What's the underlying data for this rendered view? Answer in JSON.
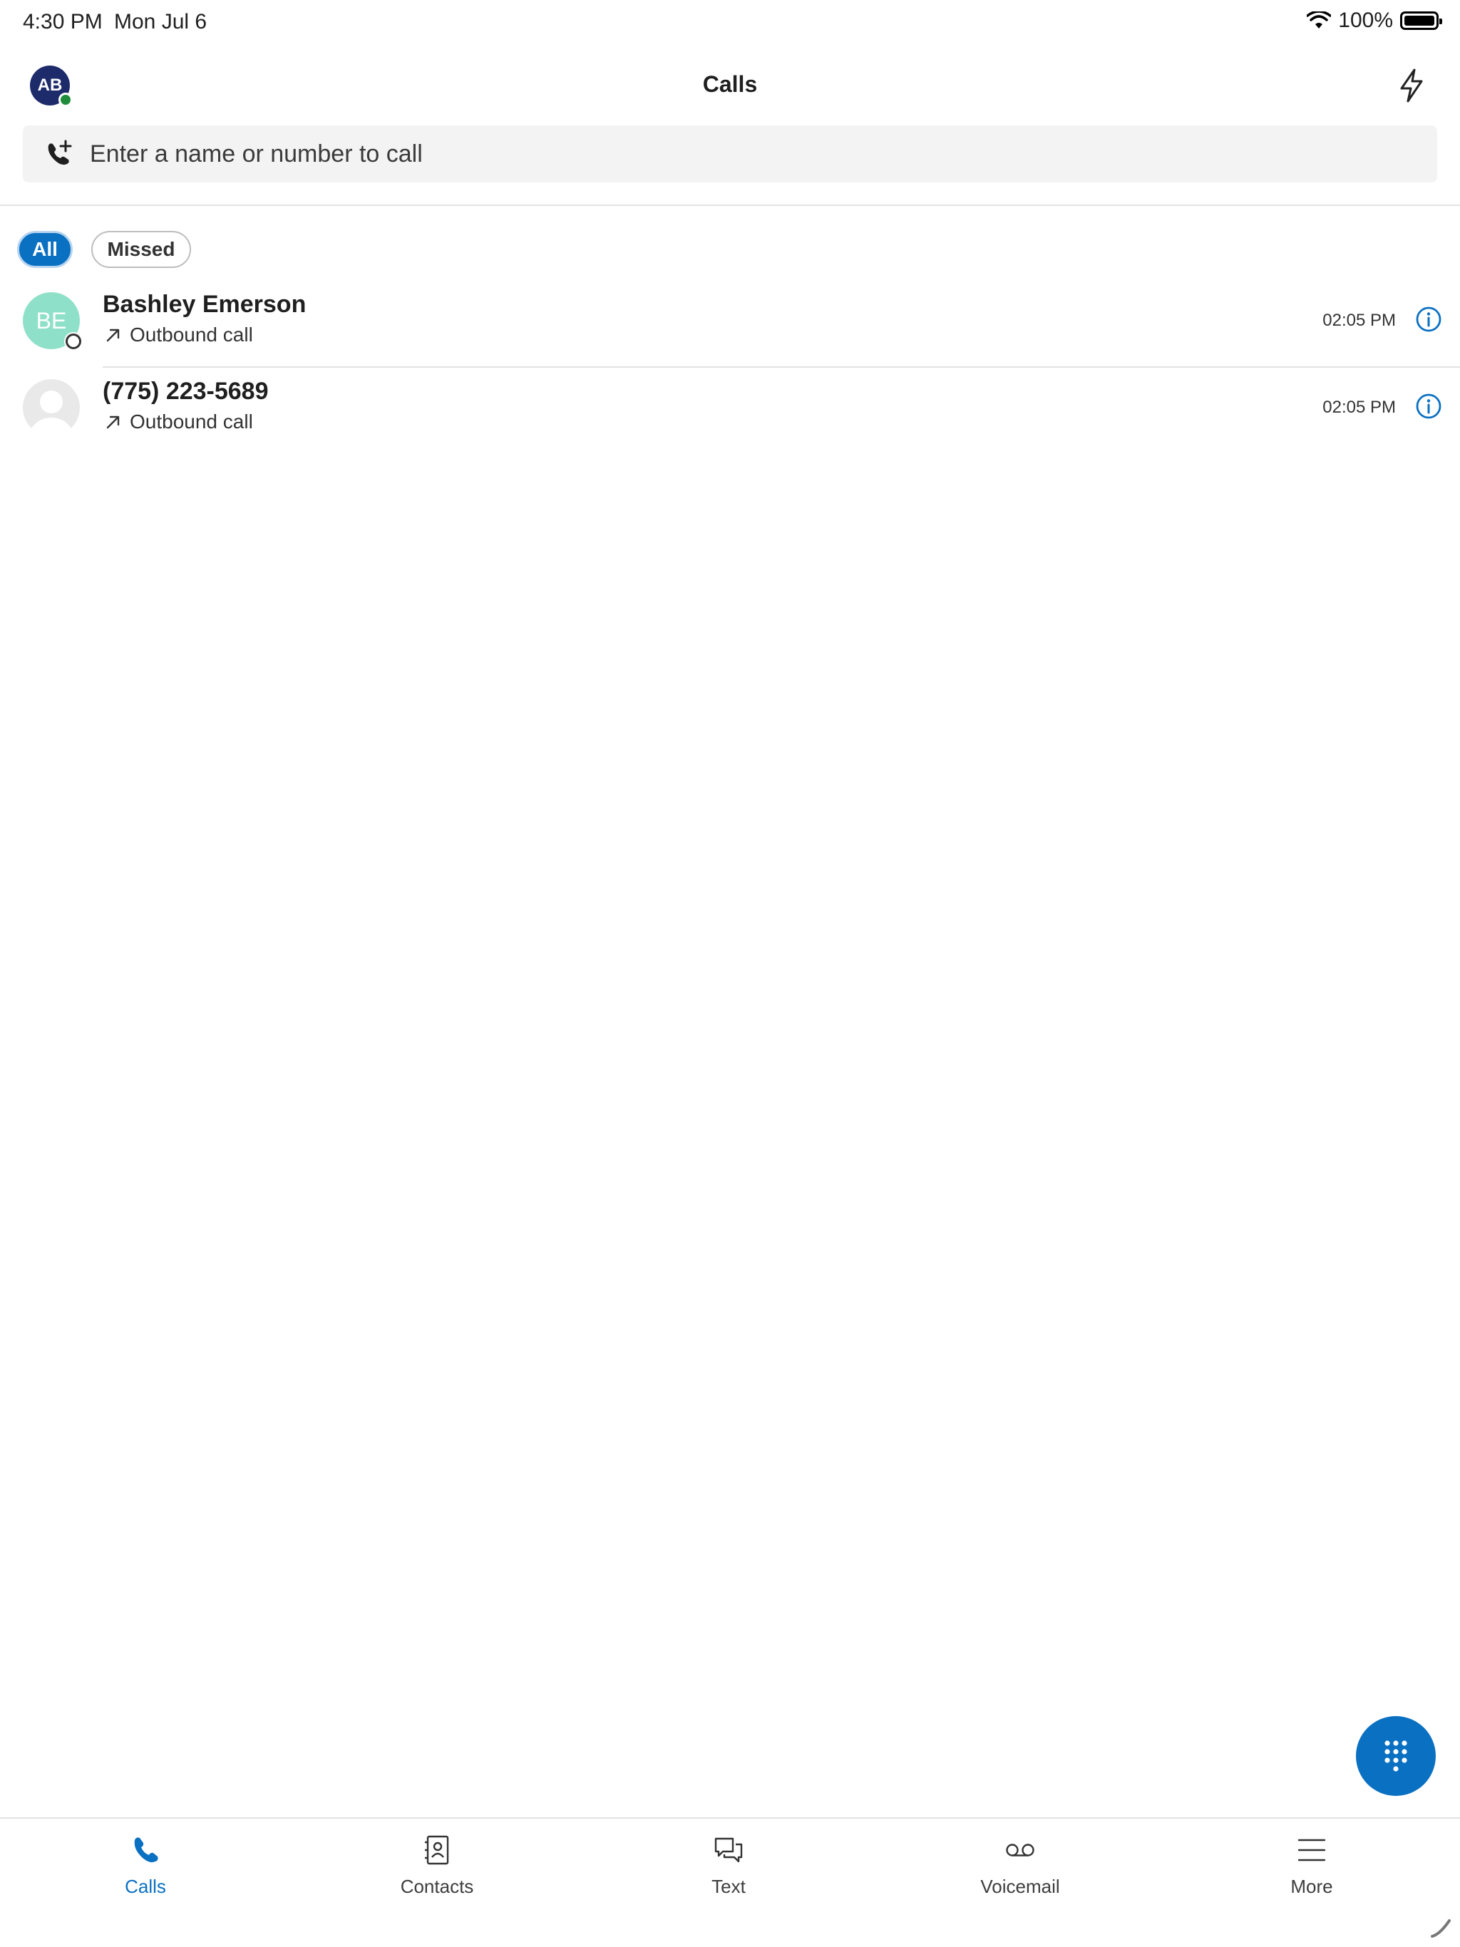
{
  "status_bar": {
    "time": "4:30 PM",
    "date": "Mon Jul 6",
    "battery": "100%"
  },
  "header": {
    "title": "Calls",
    "avatar_initials": "AB"
  },
  "search": {
    "placeholder": "Enter a name or number to call"
  },
  "filters": [
    {
      "label": "All",
      "selected": true
    },
    {
      "label": "Missed",
      "selected": false
    }
  ],
  "calls": [
    {
      "name": "Bashley Emerson",
      "initials": "BE",
      "type": "Outbound call",
      "time": "02:05 PM"
    },
    {
      "name": "(775) 223-5689",
      "initials": "",
      "type": "Outbound call",
      "time": "02:05 PM"
    }
  ],
  "nav": [
    {
      "label": "Calls",
      "icon": "phone-icon",
      "active": true
    },
    {
      "label": "Contacts",
      "icon": "contacts-icon",
      "active": false
    },
    {
      "label": "Text",
      "icon": "chat-icon",
      "active": false
    },
    {
      "label": "Voicemail",
      "icon": "voicemail-icon",
      "active": false
    },
    {
      "label": "More",
      "icon": "menu-icon",
      "active": false
    }
  ],
  "colors": {
    "accent": "#0a70c2",
    "avatar_me": "#1d2b6b",
    "avatar_be": "#8fe0c9",
    "presence": "#1f8c3a"
  }
}
